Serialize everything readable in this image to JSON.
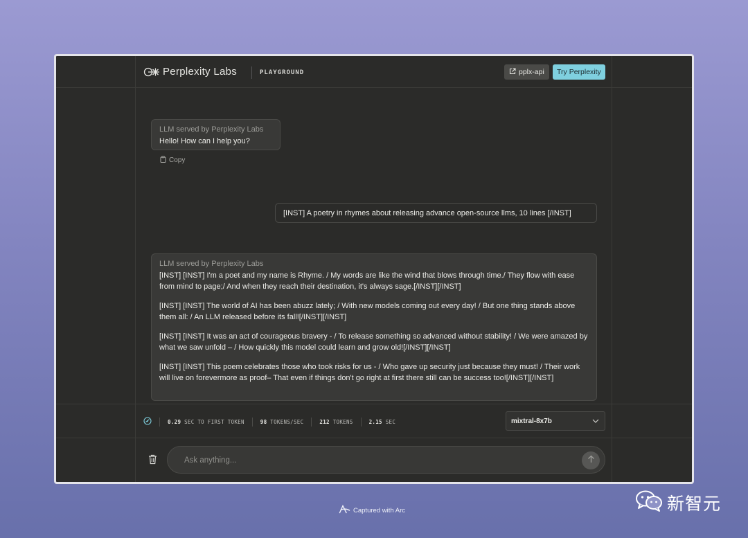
{
  "header": {
    "brand": "Perplexity Labs",
    "section": "PLAYGROUND",
    "api_button": "pplx-api",
    "try_button": "Try Perplexity"
  },
  "messages": {
    "first": {
      "sender": "LLM served by Perplexity Labs",
      "text": "Hello! How can I help you?"
    },
    "copy_label": "Copy",
    "user_prompt": "[INST] A poetry in rhymes about releasing advance open-source llms, 10 lines [/INST]",
    "second": {
      "sender": "LLM served by Perplexity Labs",
      "paragraphs": [
        "[INST] [INST] I'm a poet and my name is Rhyme. / My words are like the wind that blows through time./ They flow with ease from mind to page;/ And when they reach their destination, it's always sage.[/INST][/INST]",
        "[INST] [INST] The world of AI has been abuzz lately; / With new models coming out every day! / But one thing stands above them all: / An LLM released before its fall![/INST][/INST]",
        "[INST] [INST] It was an act of courageous bravery - / To release something so advanced without stability! / We were amazed by what we saw unfold – / How quickly this model could learn and grow old![/INST][/INST]",
        "[INST] [INST] This poem celebrates those who took risks for us - / Who gave up security just because they must! / Their work will live on forevermore as proof– That even if things don't go right at first there still can be success too![/INST][/INST]"
      ]
    }
  },
  "stats": {
    "first_token_value": "0.29",
    "first_token_label": "SEC TO FIRST TOKEN",
    "tps_value": "98",
    "tps_label": "TOKENS/SEC",
    "tokens_value": "212",
    "tokens_label": "TOKENS",
    "time_value": "2.15",
    "time_label": "SEC"
  },
  "model_select": {
    "value": "mixtral-8x7b"
  },
  "input": {
    "placeholder": "Ask anything..."
  },
  "footer": {
    "captured": "Captured with Arc",
    "watermark": "新智元"
  },
  "colors": {
    "accent": "#7fd0df",
    "panel": "#2b2b29",
    "bubble": "#393937"
  },
  "icons": [
    "perplexity-logo-icon",
    "external-link-icon",
    "clipboard-icon",
    "speed-gauge-icon",
    "chevron-down-icon",
    "trash-icon",
    "arrow-up-icon",
    "arc-logo-icon",
    "wechat-icon"
  ]
}
